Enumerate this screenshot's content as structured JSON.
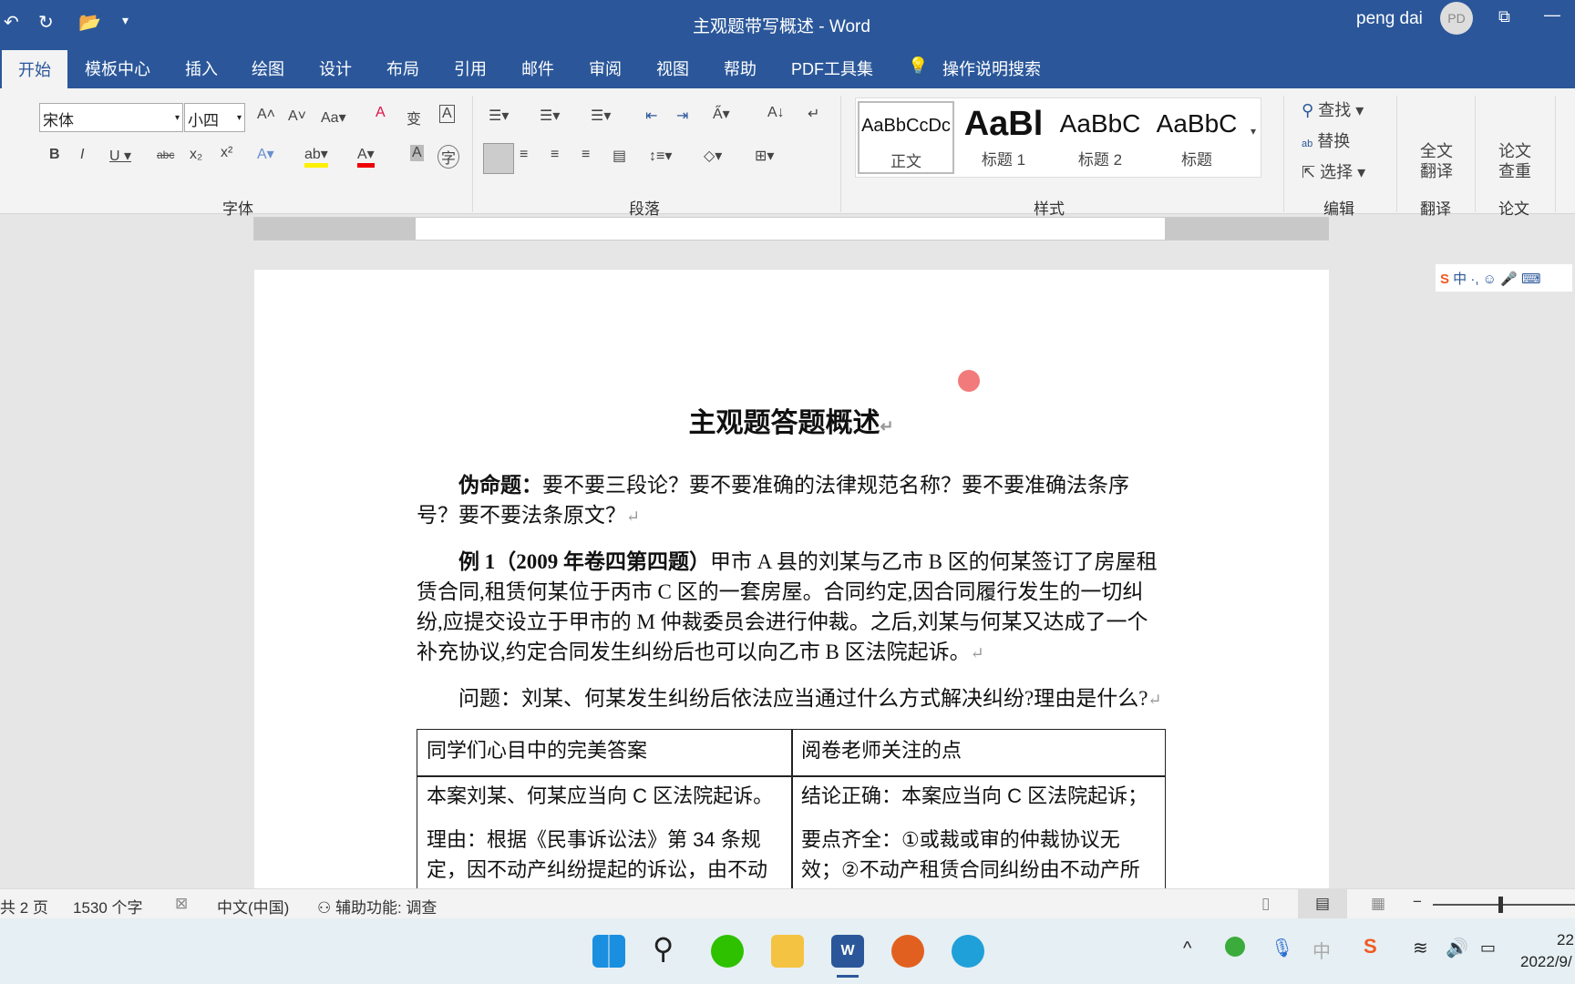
{
  "window": {
    "title": "主观题带写概述 - Word",
    "user": "peng dai",
    "avatar": "PD"
  },
  "tabs": [
    "开始",
    "模板中心",
    "插入",
    "绘图",
    "设计",
    "布局",
    "引用",
    "邮件",
    "审阅",
    "视图",
    "帮助",
    "PDF工具集",
    "操作说明搜索"
  ],
  "ribbon": {
    "font": {
      "name": "宋体",
      "size": "小四",
      "group": "字体"
    },
    "paragraph": {
      "group": "段落"
    },
    "styles": {
      "group": "样式",
      "items": [
        {
          "sample": "AaBbCcDc",
          "label": "正文"
        },
        {
          "sample": "AaBl",
          "label": "标题 1"
        },
        {
          "sample": "AaBbC",
          "label": "标题 2"
        },
        {
          "sample": "AaBbC",
          "label": "标题"
        }
      ]
    },
    "editing": {
      "group": "编辑",
      "find": "查找",
      "replace": "替换",
      "select": "选择"
    },
    "translate": {
      "group": "翻译",
      "button": "全文翻译"
    },
    "paper": {
      "group": "论文",
      "button": "论文查重"
    }
  },
  "document": {
    "title": "主观题答题概述",
    "p1_bold": "伪命题：",
    "p1": "要不要三段论？要不要准确的法律规范名称？要不要准确法条序号？要不要法条原文？",
    "p2_bold": "例 1（2009 年卷四第四题）",
    "p2": "甲市 A 县的刘某与乙市 B 区的何某签订了房屋租赁合同,租赁何某位于丙市 C 区的一套房屋。合同约定,因合同履行发生的一切纠纷,应提交设立于甲市的 M 仲裁委员会进行仲裁。之后,刘某与何某又达成了一个补充协议,约定合同发生纠纷后也可以向乙市 B 区法院起诉。",
    "p3": "问题：刘某、何某发生纠纷后依法应当通过什么方式解决纠纷?理由是什么?",
    "table": {
      "headers": [
        "同学们心目中的完美答案",
        "阅卷老师关注的点"
      ],
      "left": [
        "本案刘某、何某应当向 C 区法院起诉。",
        "理由：根据《民事诉讼法》第 34 条规定，因不动产纠纷提起的诉讼，由不动"
      ],
      "right": [
        "结论正确：本案应当向 C 区法院起诉；",
        "要点齐全：①或裁或审的仲裁协议无效；②不动产租赁合同纠纷由不动产所"
      ]
    }
  },
  "status": {
    "pages": "共 2 页",
    "words": "1530 个字",
    "language": "中文(中国)",
    "accessibility": "辅助功能: 调查"
  },
  "taskbar": {
    "time": "22",
    "date": "2022/9/"
  },
  "colors": {
    "word_blue": "#2b579a"
  }
}
